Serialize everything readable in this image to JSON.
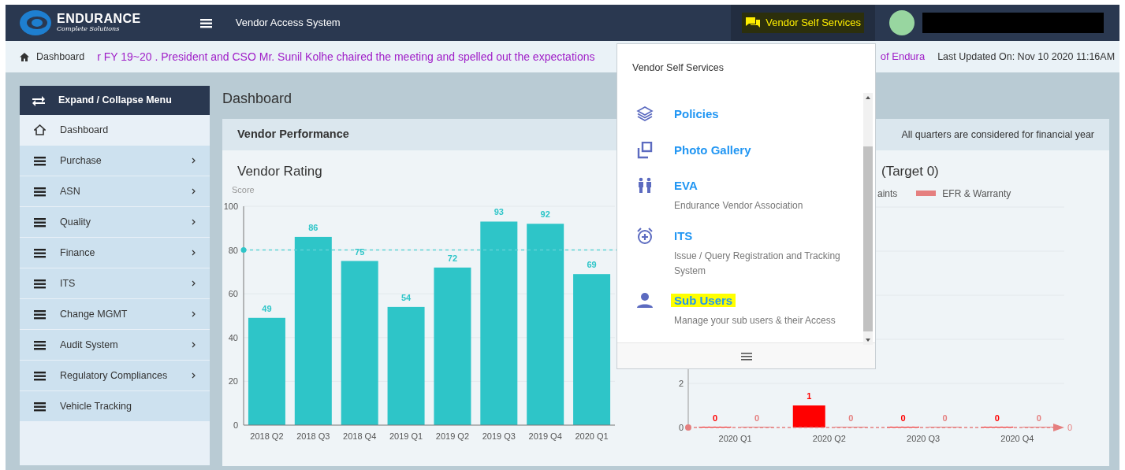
{
  "navbar": {
    "logo": {
      "name": "ENDURANCE",
      "tagline": "Complete Solutions"
    },
    "app_title": "Vendor Access System",
    "self_services_button": {
      "label": "Vendor Self Services",
      "highlighted": true
    }
  },
  "breadcrumb": {
    "label": "Dashboard"
  },
  "ticker": [
    "r FY 19~20 . President and CSO Mr. Sunil Kolhe chaired the meeting and spelled out the expectations",
    "of Endura"
  ],
  "last_updated": "Last Updated On: Nov 10 2020 11:16AM",
  "sidebar": {
    "header": "Expand / Collapse Menu",
    "items": [
      {
        "label": "Dashboard",
        "kind": "home",
        "selected": true,
        "has_submenu": false
      },
      {
        "label": "Purchase",
        "kind": "menu",
        "selected": false,
        "has_submenu": true
      },
      {
        "label": "ASN",
        "kind": "menu",
        "selected": false,
        "has_submenu": true
      },
      {
        "label": "Quality",
        "kind": "menu",
        "selected": false,
        "has_submenu": true
      },
      {
        "label": "Finance",
        "kind": "menu",
        "selected": false,
        "has_submenu": true
      },
      {
        "label": "ITS",
        "kind": "menu",
        "selected": false,
        "has_submenu": true
      },
      {
        "label": "Change MGMT",
        "kind": "menu",
        "selected": false,
        "has_submenu": true
      },
      {
        "label": "Audit System",
        "kind": "menu",
        "selected": false,
        "has_submenu": true
      },
      {
        "label": "Regulatory Compliances",
        "kind": "menu",
        "selected": false,
        "has_submenu": true
      },
      {
        "label": "Vehicle Tracking",
        "kind": "menu",
        "selected": false,
        "has_submenu": false
      }
    ]
  },
  "page_title": "Dashboard",
  "card": {
    "title": "Vendor Performance",
    "note": "All quarters are considered for financial year",
    "charts": [
      {
        "chart_data": {
          "type": "bar",
          "title": "Vendor Rating",
          "ylabel": "Score",
          "categories": [
            "2018 Q2",
            "2018 Q3",
            "2018 Q4",
            "2019 Q1",
            "2019 Q2",
            "2019 Q3",
            "2019 Q4",
            "2020 Q1"
          ],
          "values": [
            49,
            86,
            75,
            54,
            72,
            93,
            92,
            69
          ],
          "ylim": [
            0,
            100
          ],
          "yticks": [
            0,
            20,
            40,
            60,
            80,
            100
          ],
          "grid": true,
          "data_labels": true,
          "ref_lines": [
            {
              "axis": "y",
              "value": 80
            }
          ]
        }
      },
      {
        "chart_data": {
          "type": "bar",
          "title": "(Target 0)",
          "categories": [
            "2020 Q1",
            "2020 Q2",
            "2020 Q3",
            "2020 Q4"
          ],
          "series": [
            {
              "name": "aints",
              "color": "#ff0000",
              "values": [
                0,
                1,
                0,
                0
              ]
            },
            {
              "name": "EFR & Warranty",
              "color": "#e57f7f",
              "values": [
                0,
                0,
                0,
                0
              ]
            }
          ],
          "ylim": [
            0,
            10
          ],
          "yticks": [
            0,
            2
          ],
          "grid": true,
          "data_labels": true,
          "ref_lines": [
            {
              "axis": "y",
              "value": 0,
              "label": "0"
            }
          ]
        }
      }
    ]
  },
  "dropdown": {
    "title": "Vendor Self Services",
    "items": [
      {
        "kind": "layers",
        "title": "Policies",
        "highlighted": false
      },
      {
        "kind": "gallery",
        "title": "Photo Gallery",
        "highlighted": false
      },
      {
        "kind": "people",
        "title": "EVA",
        "subtitle": "Endurance Vendor Association",
        "highlighted": false
      },
      {
        "kind": "alarm",
        "title": "ITS",
        "subtitle": "Issue / Query Registration and Tracking System",
        "highlighted": false
      },
      {
        "kind": "user",
        "title": "Sub Users",
        "subtitle": "Manage your sub users & their Access",
        "highlighted": true
      }
    ]
  }
}
